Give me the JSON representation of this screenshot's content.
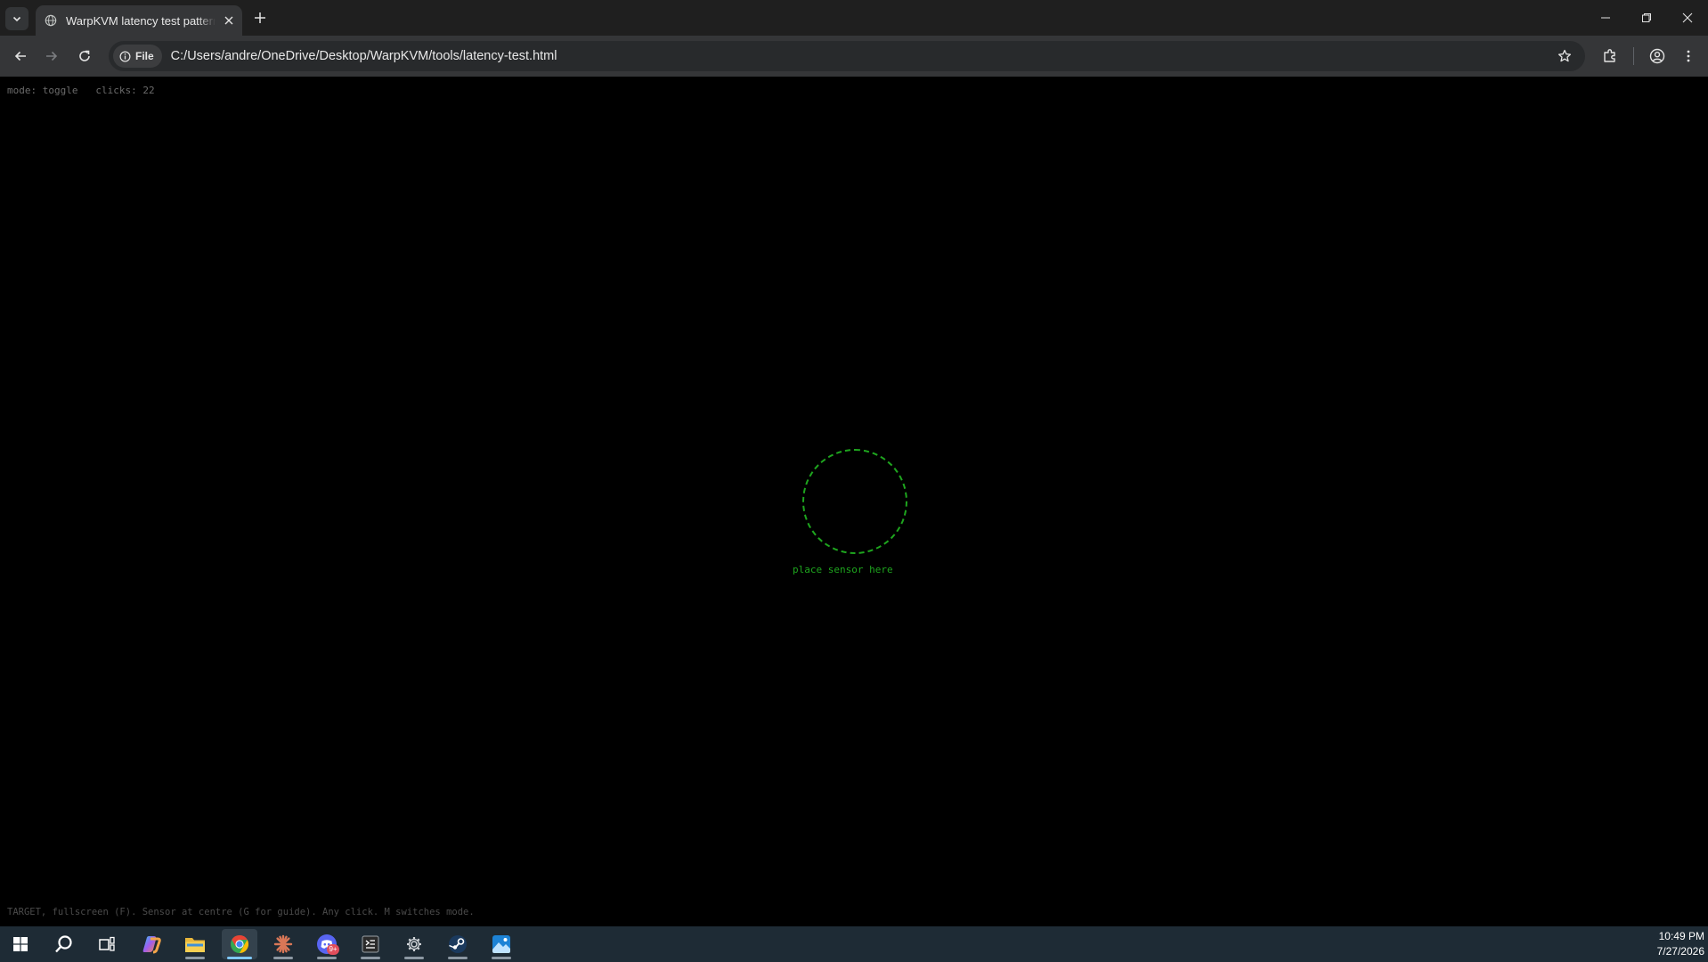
{
  "browser": {
    "tab_title": "WarpKVM latency test pattern",
    "url_scheme_chip": "File",
    "url": "C:/Users/andre/OneDrive/Desktop/WarpKVM/tools/latency-test.html"
  },
  "page": {
    "status_line": "mode: toggle   clicks: 22",
    "sensor_label": "place sensor here",
    "help_line": "TARGET, fullscreen (F). Sensor at centre (G for guide). Any click. M switches mode.",
    "ring_color": "#1ea51e"
  },
  "taskbar": {
    "apps": [
      "start-icon",
      "search-icon",
      "task-view-icon",
      "copilot-icon",
      "file-explorer-icon",
      "chrome-icon",
      "claude-icon",
      "discord-icon",
      "terminal-icon",
      "settings-icon",
      "steam-icon",
      "photos-icon"
    ],
    "discord_badge": "9+",
    "time": "10:49 PM",
    "date": "7/27/2026"
  }
}
